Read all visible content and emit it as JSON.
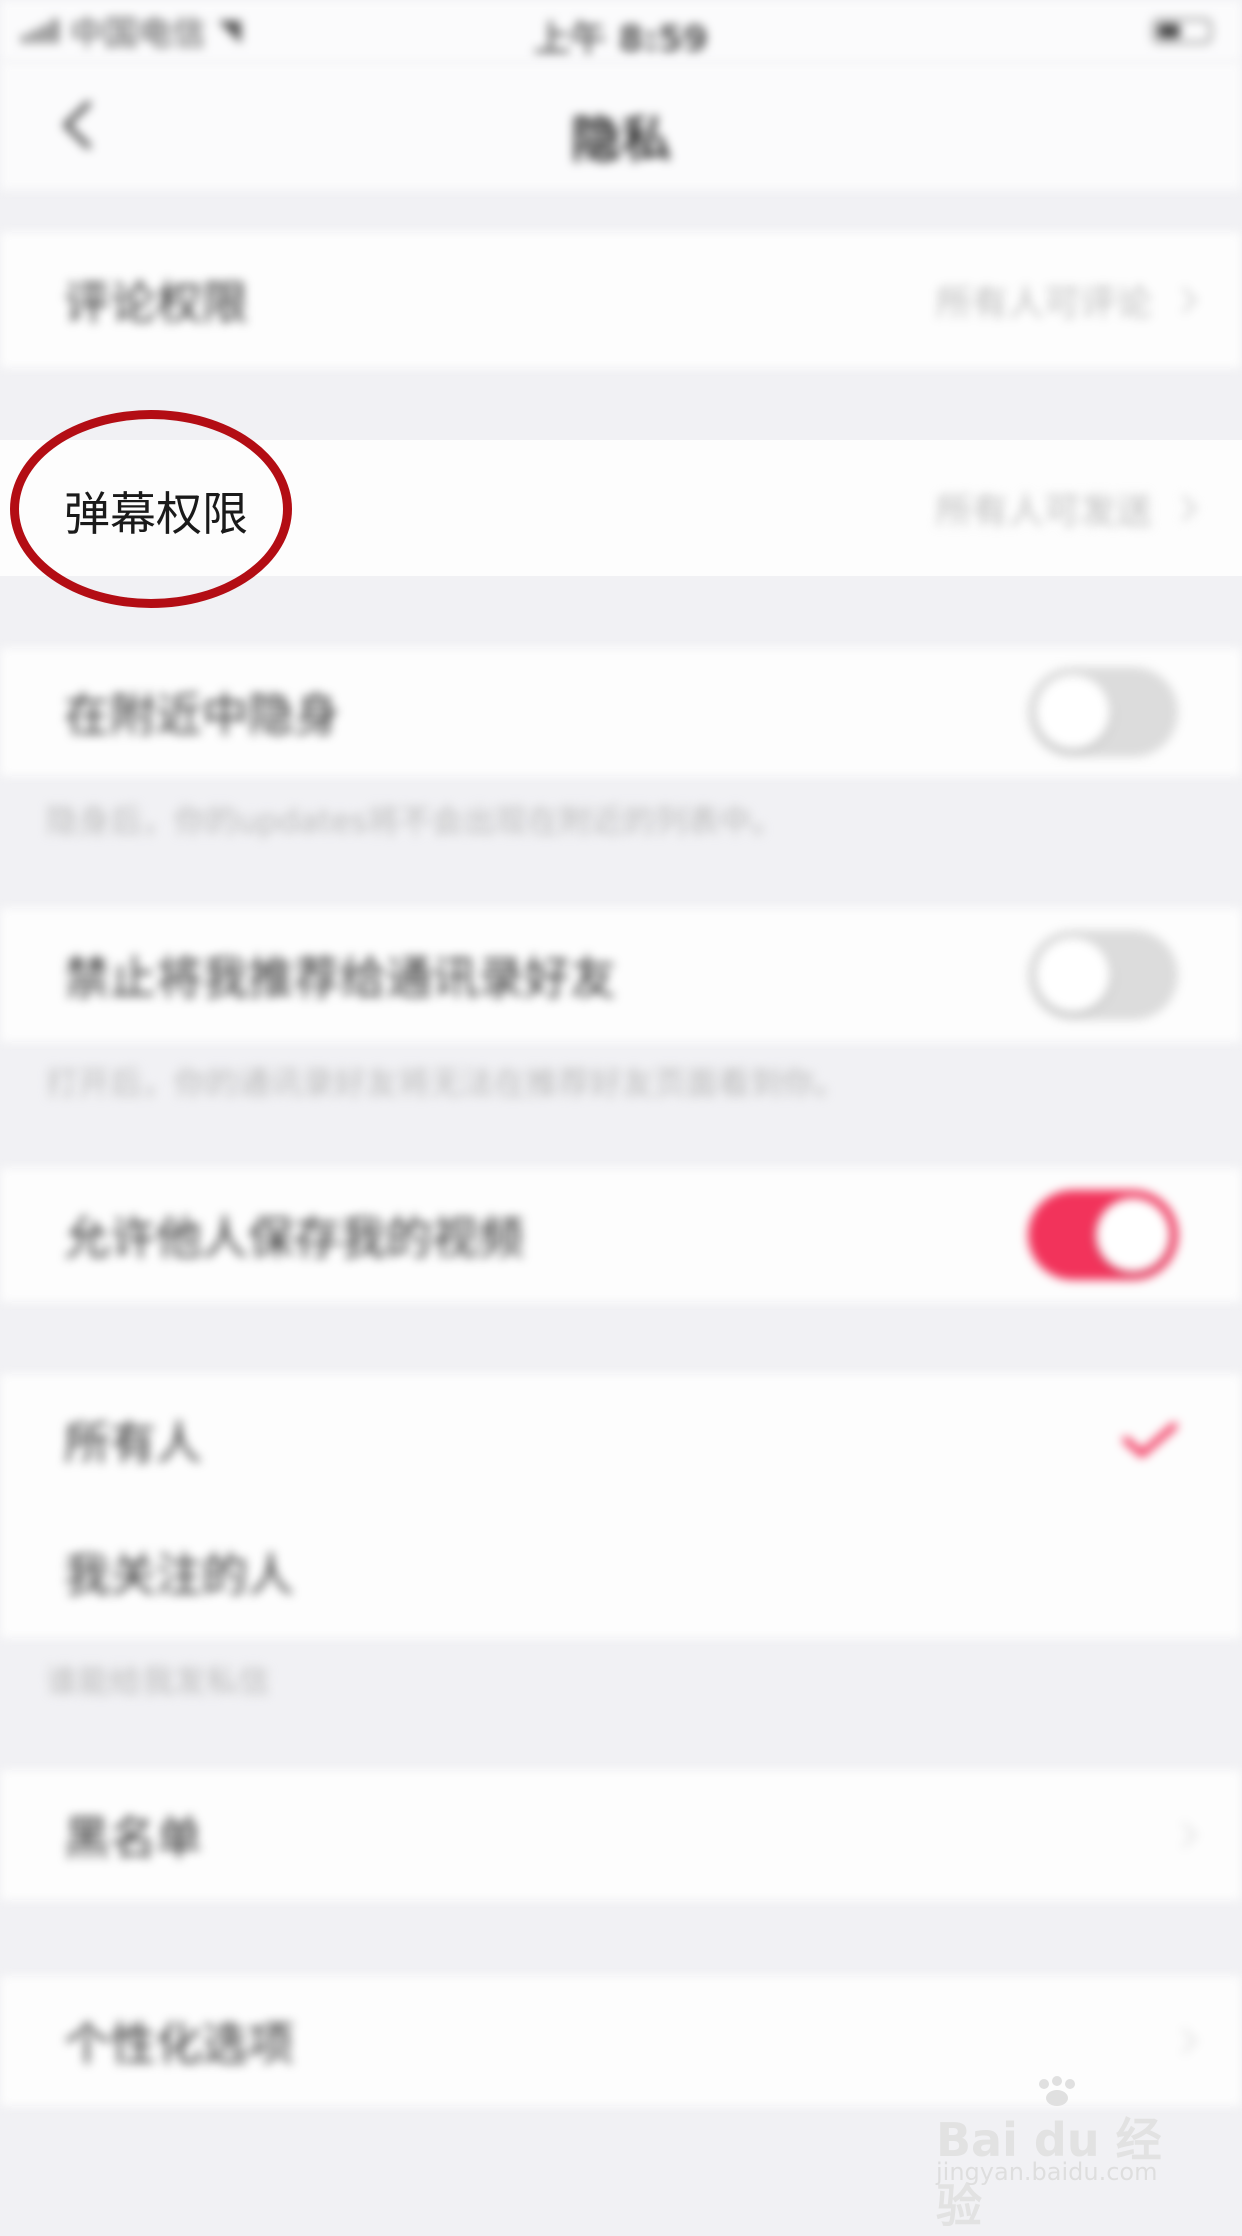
{
  "status_bar": {
    "carrier": "中国电信",
    "time": "上午 8:59"
  },
  "nav": {
    "title": "隐私"
  },
  "rows": {
    "comment": {
      "label": "评论权限",
      "value": "所有人可评论"
    },
    "danmaku": {
      "label": "弹幕权限",
      "value": "所有人可发送"
    },
    "hide_nearby": {
      "label": "在附近中隐身",
      "hint": "隐身后，你的updates将不会出现在附近的列表中。",
      "enabled": false
    },
    "no_recommend": {
      "label": "禁止将我推荐给通讯录好友",
      "hint": "打开后，你的通讯录好友将无法在推荐好友页面看到你。",
      "enabled": false
    },
    "allow_save": {
      "label": "允许他人保存我的视频",
      "enabled": true
    },
    "everyone": {
      "label": "所有人",
      "selected": true
    },
    "following": {
      "label": "我关注的人",
      "selected": false
    },
    "private_msg_hint": "谁能给我发私信",
    "blacklist": {
      "label": "黑名单"
    },
    "personalize": {
      "label": "个性化选项"
    }
  },
  "highlight": {
    "label": "弹幕权限",
    "color": "#b30d14"
  },
  "colors": {
    "accent": "#f2335b",
    "background": "#f1f1f4"
  },
  "watermark": {
    "brand": "Bai du 经验",
    "url": "jingyan.baidu.com"
  }
}
